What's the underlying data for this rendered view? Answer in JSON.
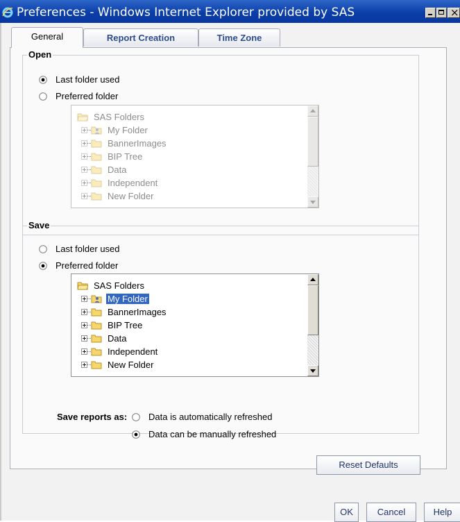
{
  "window": {
    "title": "Preferences - Windows Internet Explorer provided by SAS",
    "icon": "ie-icon",
    "buttons": [
      "minimize-icon",
      "maximize-icon",
      "close-icon"
    ]
  },
  "tabs": [
    {
      "label": "General",
      "active": true
    },
    {
      "label": "Report Creation",
      "active": false
    },
    {
      "label": "Time Zone",
      "active": false
    }
  ],
  "open": {
    "legend": "Open",
    "options": [
      {
        "label": "Last folder used",
        "selected": true
      },
      {
        "label": "Preferred folder",
        "selected": false
      }
    ],
    "tree": {
      "enabled": false,
      "root": "SAS Folders",
      "items": [
        "My Folder",
        "BannerImages",
        "BIP Tree",
        "Data",
        "Independent",
        "New Folder"
      ]
    }
  },
  "save": {
    "legend": "Save",
    "options": [
      {
        "label": "Last folder used",
        "selected": false
      },
      {
        "label": "Preferred folder",
        "selected": true
      }
    ],
    "tree": {
      "enabled": true,
      "root": "SAS Folders",
      "items": [
        "My Folder",
        "BannerImages",
        "BIP Tree",
        "Data",
        "Independent",
        "New Folder"
      ],
      "selected_item": "My Folder"
    },
    "save_reports_as_label": "Save reports as:",
    "report_options": [
      {
        "label": "Data is automatically refreshed",
        "selected": false
      },
      {
        "label": "Data can be manually refreshed",
        "selected": true
      }
    ]
  },
  "buttons": {
    "reset_defaults": "Reset Defaults",
    "ok": "OK",
    "cancel": "Cancel",
    "help": "Help"
  },
  "colors": {
    "titlebar": "#0b3ea8",
    "selection": "#3166c4",
    "tab_text": "#2b4c8c"
  }
}
